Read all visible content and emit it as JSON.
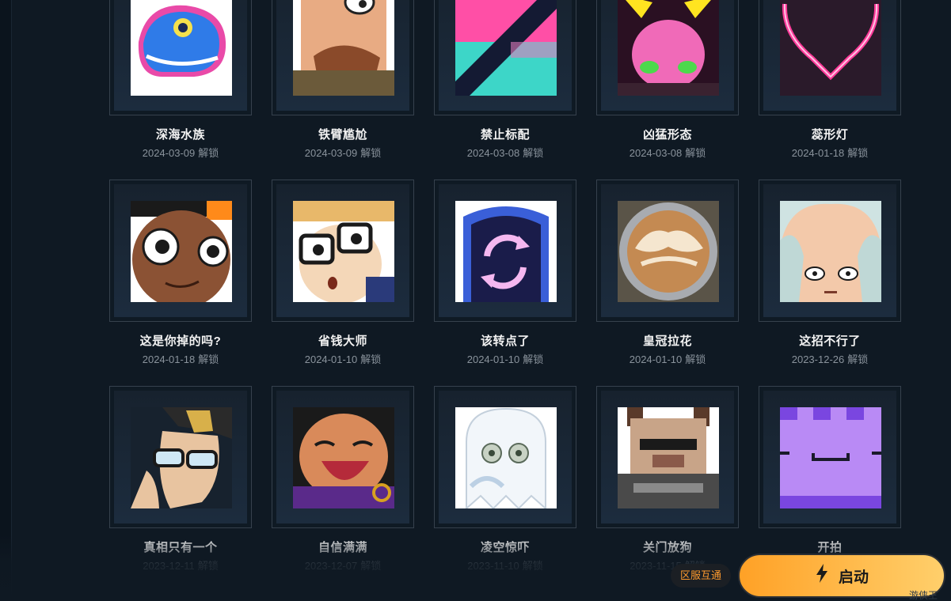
{
  "items": [
    {
      "name": "深海水族",
      "date": "2024-03-09",
      "art": "sea-creature-spray-icon"
    },
    {
      "name": "铁臂尴尬",
      "date": "2024-03-09",
      "art": "bearded-agent-spray-icon"
    },
    {
      "name": "禁止标配",
      "date": "2024-03-08",
      "art": "prohibited-gun-spray-icon"
    },
    {
      "name": "凶猛形态",
      "date": "2024-03-08",
      "art": "fierce-slime-spray-icon"
    },
    {
      "name": "蕊形灯",
      "date": "2024-01-18",
      "art": "neon-heart-spray-icon"
    },
    {
      "name": "这是你掉的吗?",
      "date": "2024-01-18",
      "art": "curious-kid-spray-icon"
    },
    {
      "name": "省钱大师",
      "date": "2024-01-10",
      "art": "glasses-agent-spray-icon"
    },
    {
      "name": "该转点了",
      "date": "2024-01-10",
      "art": "rotate-sign-spray-icon"
    },
    {
      "name": "皇冠拉花",
      "date": "2024-01-10",
      "art": "latte-art-spray-icon"
    },
    {
      "name": "这招不行了",
      "date": "2023-12-26",
      "art": "worried-agent-spray-icon"
    },
    {
      "name": "真相只有一个",
      "date": "2023-12-11",
      "art": "detective-agent-spray-icon"
    },
    {
      "name": "自信满满",
      "date": "2023-12-07",
      "art": "laughing-agent-spray-icon"
    },
    {
      "name": "凌空惊吓",
      "date": "2023-11-10",
      "art": "ghost-spray-icon"
    },
    {
      "name": "关门放狗",
      "date": "2023-11-15",
      "art": "pixel-dog-spray-icon"
    },
    {
      "name": "开拍",
      "date": "",
      "art": "purple-castle-spray-icon"
    }
  ],
  "unlock_suffix": "解锁",
  "region_badge": "区服互通",
  "launch_button": {
    "label": "启动",
    "icon": "lightning-bolt-icon"
  },
  "watermark": "游侠王",
  "colors": {
    "background": "#0f1923",
    "card_border": "#36414d",
    "accent_orange": "#ff9b2e",
    "button_gradient_start": "#ffa126",
    "button_gradient_end": "#ffcf6b"
  }
}
